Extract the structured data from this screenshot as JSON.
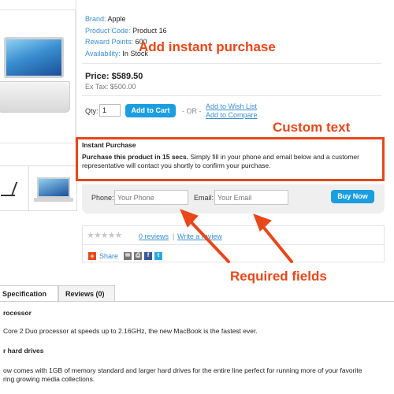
{
  "product": {
    "brand_label": "Brand:",
    "brand": "Apple",
    "code_label": "Product Code:",
    "code": "Product 16",
    "reward_label": "Reward Points:",
    "reward": "600",
    "availability_label": "Availability:",
    "availability": "In Stock",
    "price": "Price: $589.50",
    "ex_tax": "Ex Tax: $500.00"
  },
  "cart": {
    "qty_label": "Qty:",
    "qty_value": "1",
    "add_to_cart": "Add to Cart",
    "or_text": "- OR -",
    "wish_list": "Add to Wish List",
    "compare": "Add to Compare"
  },
  "annotations": {
    "add_instant": "Add instant purchase",
    "custom_text": "Custom text",
    "required_fields": "Required fields"
  },
  "instant_purchase": {
    "title": "Instant Purchase",
    "bold_text": "Purchase this product in 15 secs.",
    "text": " Simply fill in your phone and email below and a customer representative will contact you shortly to confirm your purchase.",
    "phone_label": "Phone:",
    "phone_placeholder": "Your Phone",
    "email_label": "Email:",
    "email_placeholder": "Your Email",
    "buy_now": "Buy Now"
  },
  "reviews": {
    "stars": "★★★★★",
    "count_link": "0 reviews",
    "separator": "|",
    "write_link": "Write a review",
    "share_label": "Share",
    "social_icons": [
      "add-share-icon",
      "email-icon",
      "print-icon",
      "facebook-icon",
      "twitter-icon"
    ]
  },
  "tabs": {
    "specification": "Specification",
    "reviews": "Reviews (0)"
  },
  "description": {
    "heading1": "rocessor",
    "line1": "Core 2 Duo processor at speeds up to 2.16GHz, the new MacBook is the fastest ever.",
    "heading2": "r hard drives",
    "line2": "ow comes with 1GB of memory standard and larger hard drives for the entire line perfect for running more of your favorite",
    "line3": "ring growing media collections."
  },
  "colors": {
    "accent_blue": "#1a9ee0",
    "link_blue": "#3a8ecf",
    "annotation_red": "#e8471a"
  }
}
